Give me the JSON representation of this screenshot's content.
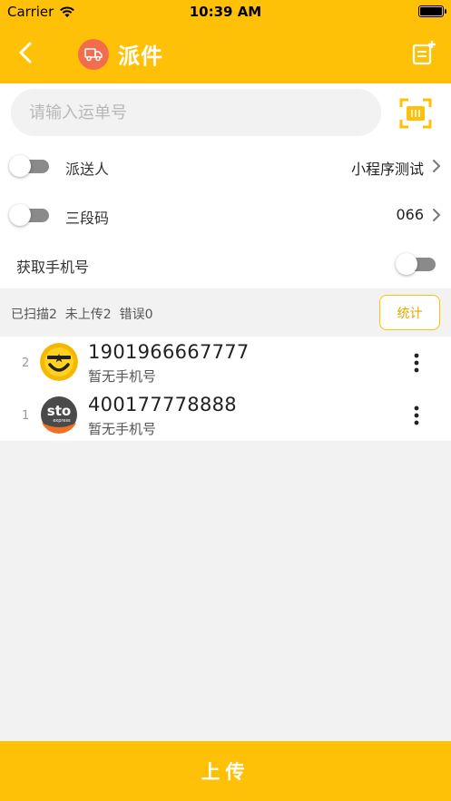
{
  "status_bar": {
    "carrier": "Carrier",
    "time": "10:39 AM"
  },
  "header": {
    "title": "派件"
  },
  "search": {
    "placeholder": "请输入运单号"
  },
  "settings": {
    "courier": {
      "label": "派送人",
      "value": "小程序测试"
    },
    "three_code": {
      "label": "三段码",
      "value": "066"
    },
    "fetch_phone": {
      "label": "获取手机号"
    }
  },
  "stats": {
    "summary": "已扫描2  未上传2  错误0",
    "button_label": "统计"
  },
  "items": [
    {
      "index": "2",
      "tracking_no": "1901966667777",
      "phone": "暂无手机号",
      "logo": "smiley-courier-logo"
    },
    {
      "index": "1",
      "tracking_no": "400177778888",
      "phone": "暂无手机号",
      "logo": "sto-express-logo",
      "logo_text": "sto",
      "logo_subtext": "express"
    }
  ],
  "footer": {
    "upload_label": "上传"
  },
  "colors": {
    "primary": "#ffc107",
    "badge": "#f46c4e"
  }
}
